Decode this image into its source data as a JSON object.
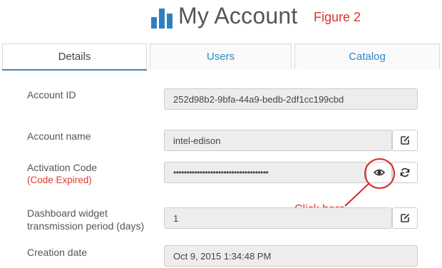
{
  "header": {
    "title": "My Account",
    "figure_label": "Figure 2",
    "logo_icon": "bar-chart-icon",
    "logo_color": "#2f80c3"
  },
  "tabs": [
    {
      "label": "Details",
      "active": true
    },
    {
      "label": "Users",
      "active": false
    },
    {
      "label": "Catalog",
      "active": false
    }
  ],
  "details": {
    "account_id": {
      "label": "Account ID",
      "value": "252d98b2-9bfa-44a9-bedb-2df1cc199cbd"
    },
    "account_name": {
      "label": "Account name",
      "value": "intel-edison",
      "action_icon": "edit-icon"
    },
    "activation_code": {
      "label": "Activation Code",
      "status": "(Code Expired)",
      "value": "••••••••••••••••••••••••••••••••••••",
      "reveal_icon": "eye-icon",
      "refresh_icon": "refresh-icon"
    },
    "dashboard_widget": {
      "label_line1": "Dashboard widget",
      "label_line2": "transmission period (days)",
      "value": "1",
      "action_icon": "edit-icon"
    },
    "creation_date": {
      "label": "Creation date",
      "value": "Oct 9, 2015 1:34:48 PM"
    }
  },
  "annotation": {
    "text": "Click here",
    "color": "#d92525"
  },
  "colors": {
    "accent": "#3b87c9",
    "link": "#2e8ac7",
    "error": "#e5382c"
  }
}
